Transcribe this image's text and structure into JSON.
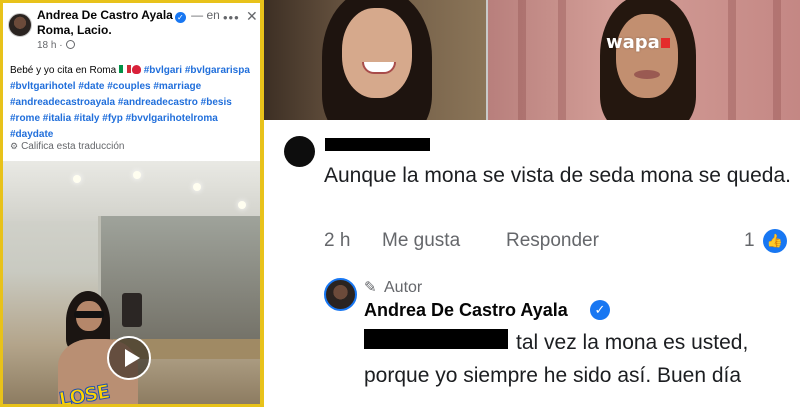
{
  "post": {
    "author": "Andrea De Castro Ayala",
    "location_sep": " — en",
    "location": "Roma, Lacio.",
    "time": "18 h ·",
    "text_intro": "Bebé y yo cita en Roma",
    "hashtags_line1": "#bvlgari",
    "hashtags": "#bvlgararispa #bvltgarihotel #date #couples #marriage #andreadecastroayala #andreadecastro #besis #rome #italia #italy #fyp #bvvlgarihotelroma #daydate",
    "translate": "Califica esta traducción",
    "sticker": "LOSE"
  },
  "banner": {
    "logo": "wapa"
  },
  "comment1": {
    "text": "Aunque la mona se vista de seda mona se queda.",
    "time": "2 h",
    "like": "Me gusta",
    "reply": "Responder",
    "reaction_count": "1"
  },
  "reply": {
    "badge": "Autor",
    "name": "Andrea De Castro Ayala",
    "text": "tal vez la mona es usted, porque yo siempre he sido así. Buen día"
  },
  "icons": {
    "verified": "verified-badge-icon",
    "like": "thumbs-up-icon",
    "pencil": "pencil-icon",
    "globe": "globe-icon",
    "gear": "gear-icon",
    "play": "play-icon"
  },
  "colors": {
    "accent": "#1877f2",
    "hashtag": "#216fdb",
    "frame": "#e8c21a",
    "muted": "#65676b"
  }
}
